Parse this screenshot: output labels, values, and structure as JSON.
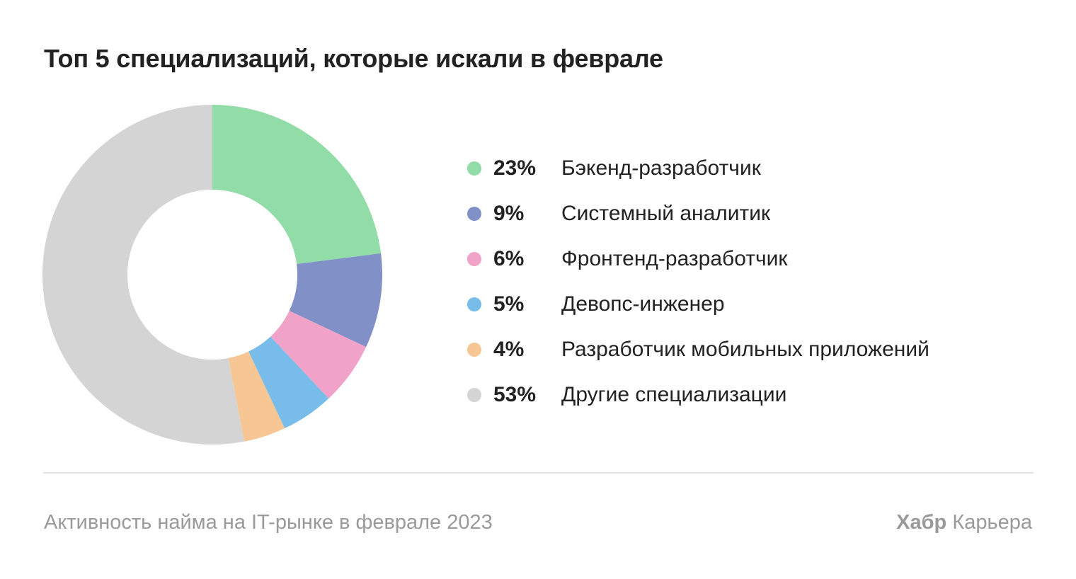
{
  "title": "Топ 5 специализаций, которые искали в феврале",
  "footnote": "Активность найма на IT-рынке в феврале 2023",
  "brand": {
    "bold": "Хабр",
    "regular": "Карьера"
  },
  "chart_data": {
    "type": "pie",
    "title": "Топ 5 специализаций, которые искали в феврале",
    "categories": [
      "Бэкенд-разработчик",
      "Системный аналитик",
      "Фронтенд-разработчик",
      "Девопс-инженер",
      "Разработчик мобильных приложений",
      "Другие специализации"
    ],
    "values": [
      23,
      9,
      6,
      5,
      4,
      53
    ],
    "labels": [
      "23%",
      "9%",
      "6%",
      "5%",
      "4%",
      "53%"
    ],
    "colors": [
      "#92dca7",
      "#8290c8",
      "#f0a2c8",
      "#78bce9",
      "#f6c795",
      "#d4d4d4"
    ],
    "donut": true,
    "legend": "right"
  }
}
